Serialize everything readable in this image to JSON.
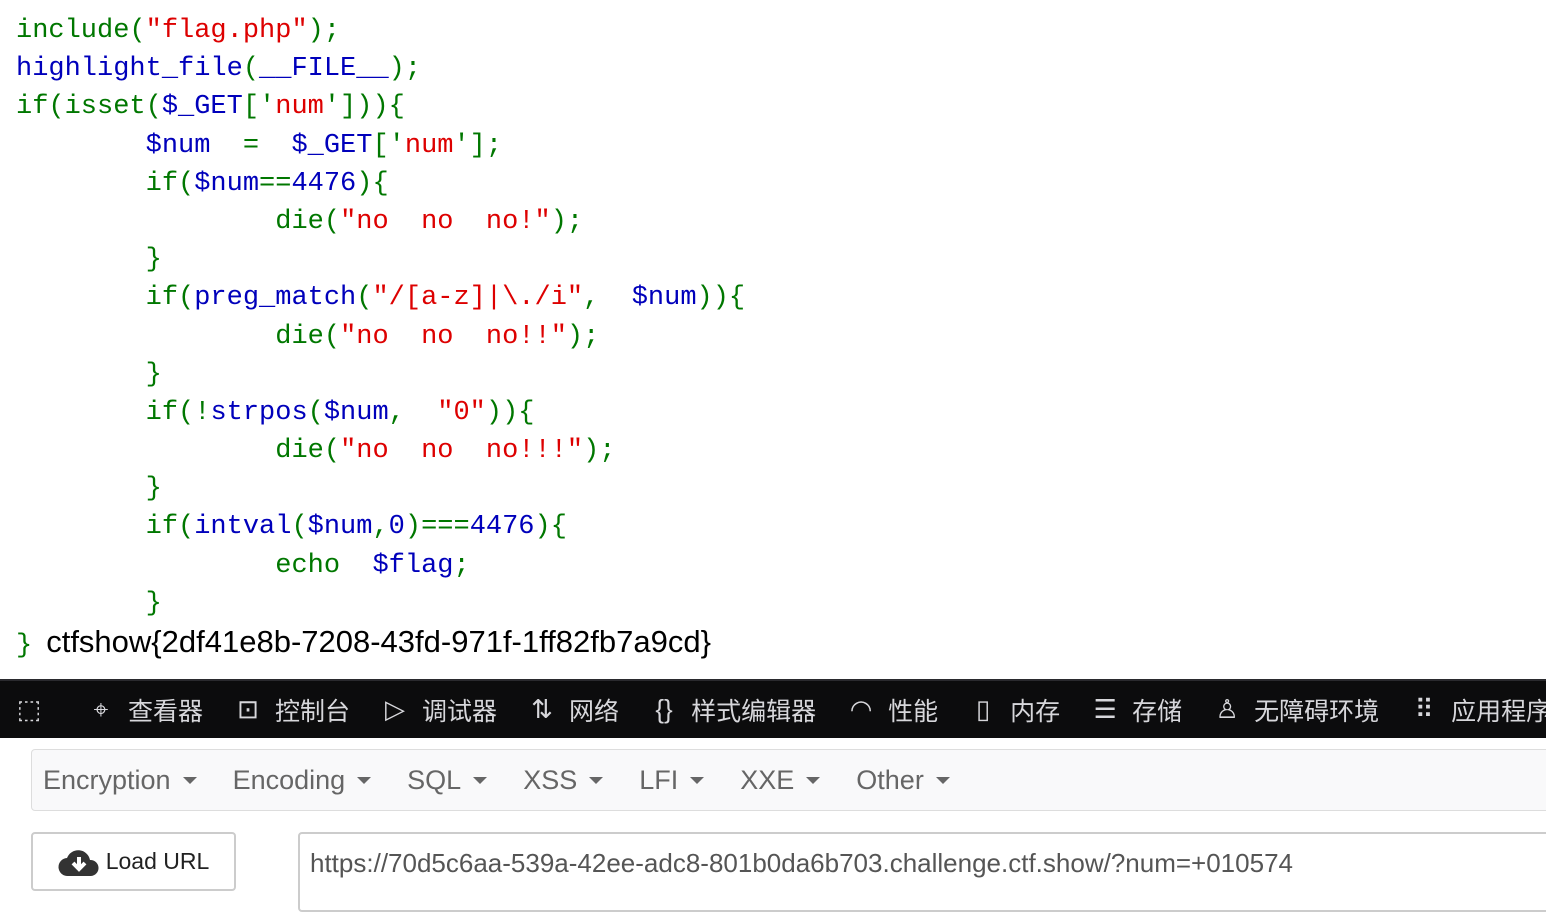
{
  "colors": {
    "keyword": "#007700",
    "default": "#0000BB",
    "string": "#DD0000"
  },
  "code": [
    {
      "indent": 0,
      "tokens": [
        [
          "include(",
          "g"
        ],
        [
          "\"flag.php\"",
          "r"
        ],
        [
          ");",
          "g"
        ]
      ]
    },
    {
      "indent": 0,
      "tokens": [
        [
          "highlight_file",
          "b"
        ],
        [
          "(",
          "g"
        ],
        [
          "__FILE__",
          "b"
        ],
        [
          ");",
          "g"
        ]
      ]
    },
    {
      "indent": 0,
      "tokens": [
        [
          "if(isset(",
          "g"
        ],
        [
          "$_GET",
          "b"
        ],
        [
          "['",
          "g"
        ],
        [
          "num",
          "r"
        ],
        [
          "']",
          "g"
        ],
        [
          ")){",
          "g"
        ]
      ]
    },
    {
      "indent": 8,
      "tokens": [
        [
          "$num  ",
          "b"
        ],
        [
          "=  ",
          "g"
        ],
        [
          "$_GET",
          "b"
        ],
        [
          "['",
          "g"
        ],
        [
          "num",
          "r"
        ],
        [
          "'];",
          "g"
        ]
      ]
    },
    {
      "indent": 8,
      "tokens": [
        [
          "if(",
          "g"
        ],
        [
          "$num",
          "b"
        ],
        [
          "==",
          "g"
        ],
        [
          "4476",
          "b"
        ],
        [
          "){",
          "g"
        ]
      ]
    },
    {
      "indent": 16,
      "tokens": [
        [
          "die(",
          "g"
        ],
        [
          "\"no  no  no!\"",
          "r"
        ],
        [
          ");",
          "g"
        ]
      ]
    },
    {
      "indent": 8,
      "tokens": [
        [
          "}",
          "g"
        ]
      ]
    },
    {
      "indent": 8,
      "tokens": [
        [
          "if(",
          "g"
        ],
        [
          "preg_match",
          "b"
        ],
        [
          "(",
          "g"
        ],
        [
          "\"/[a-z]|\\./i\"",
          "r"
        ],
        [
          ",  ",
          "g"
        ],
        [
          "$num",
          "b"
        ],
        [
          ")){",
          "g"
        ]
      ]
    },
    {
      "indent": 16,
      "tokens": [
        [
          "die(",
          "g"
        ],
        [
          "\"no  no  no!!\"",
          "r"
        ],
        [
          ");",
          "g"
        ]
      ]
    },
    {
      "indent": 8,
      "tokens": [
        [
          "}",
          "g"
        ]
      ]
    },
    {
      "indent": 8,
      "tokens": [
        [
          "if(!",
          "g"
        ],
        [
          "strpos",
          "b"
        ],
        [
          "(",
          "g"
        ],
        [
          "$num",
          "b"
        ],
        [
          ",  ",
          "g"
        ],
        [
          "\"0\"",
          "r"
        ],
        [
          ")){",
          "g"
        ]
      ]
    },
    {
      "indent": 16,
      "tokens": [
        [
          "die(",
          "g"
        ],
        [
          "\"no  no  no!!!\"",
          "r"
        ],
        [
          ");",
          "g"
        ]
      ]
    },
    {
      "indent": 8,
      "tokens": [
        [
          "}",
          "g"
        ]
      ]
    },
    {
      "indent": 8,
      "tokens": [
        [
          "if(",
          "g"
        ],
        [
          "intval",
          "b"
        ],
        [
          "(",
          "g"
        ],
        [
          "$num",
          "b"
        ],
        [
          ",",
          "g"
        ],
        [
          "0",
          "b"
        ],
        [
          ")===",
          "g"
        ],
        [
          "4476",
          "b"
        ],
        [
          "){",
          "g"
        ]
      ]
    },
    {
      "indent": 16,
      "tokens": [
        [
          "echo  ",
          "g"
        ],
        [
          "$flag",
          "b"
        ],
        [
          ";",
          "g"
        ]
      ]
    },
    {
      "indent": 8,
      "tokens": [
        [
          "}",
          "g"
        ]
      ]
    },
    {
      "indent": 0,
      "tokens": [
        [
          "}",
          "g"
        ]
      ]
    }
  ],
  "output": "ctfshow{2df41e8b-7208-43fd-971f-1ff82fb7a9cd}",
  "devtools": {
    "tabs": [
      {
        "label": "查看器",
        "icon": "inspector-icon"
      },
      {
        "label": "控制台",
        "icon": "console-icon"
      },
      {
        "label": "调试器",
        "icon": "debugger-icon"
      },
      {
        "label": "网络",
        "icon": "network-icon"
      },
      {
        "label": "样式编辑器",
        "icon": "style-editor-icon"
      },
      {
        "label": "性能",
        "icon": "performance-icon"
      },
      {
        "label": "内存",
        "icon": "memory-icon"
      },
      {
        "label": "存储",
        "icon": "storage-icon"
      },
      {
        "label": "无障碍环境",
        "icon": "accessibility-icon"
      },
      {
        "label": "应用程序",
        "icon": "application-icon"
      }
    ]
  },
  "hackbar": {
    "menus": [
      "Encryption",
      "Encoding",
      "SQL",
      "XSS",
      "LFI",
      "XXE",
      "Other"
    ],
    "load_url": "Load URL",
    "url": "https://70d5c6aa-539a-42ee-adc8-801b0da6b703.challenge.ctf.show/?num=+010574"
  }
}
